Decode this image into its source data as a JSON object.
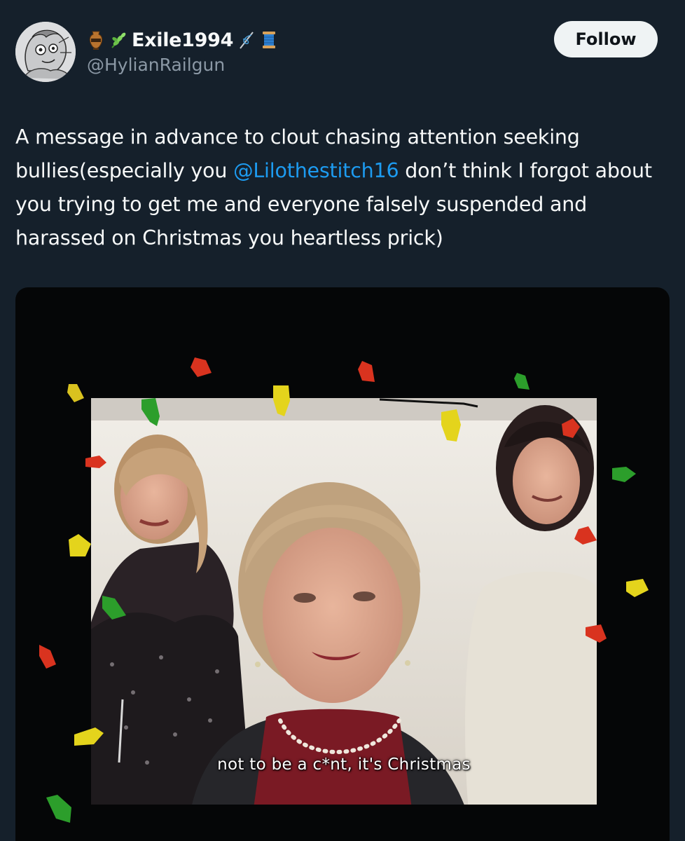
{
  "author": {
    "display_name": "Exile1994",
    "handle": "@HylianRailgun",
    "name_emojis_before": [
      "amphora-icon",
      "herb-icon"
    ],
    "name_emojis_after": [
      "needle-thread-icon",
      "spool-icon"
    ]
  },
  "follow": {
    "label": "Follow"
  },
  "tweet": {
    "text_part1": "A message in advance to clout chasing attention seeking bullies(especially you ",
    "mention": "@Lilothestitch16",
    "text_part2": " don’t think I forgot about you trying to get me and everyone falsely suspended and harassed on Christmas you heartless prick)"
  },
  "media": {
    "caption": "not to be a c*nt, it's Christmas"
  },
  "colors": {
    "background": "#15202b",
    "text": "#f7f9f9",
    "secondary_text": "#8b98a5",
    "link": "#1d9bf0",
    "button_bg": "#eff3f4"
  }
}
